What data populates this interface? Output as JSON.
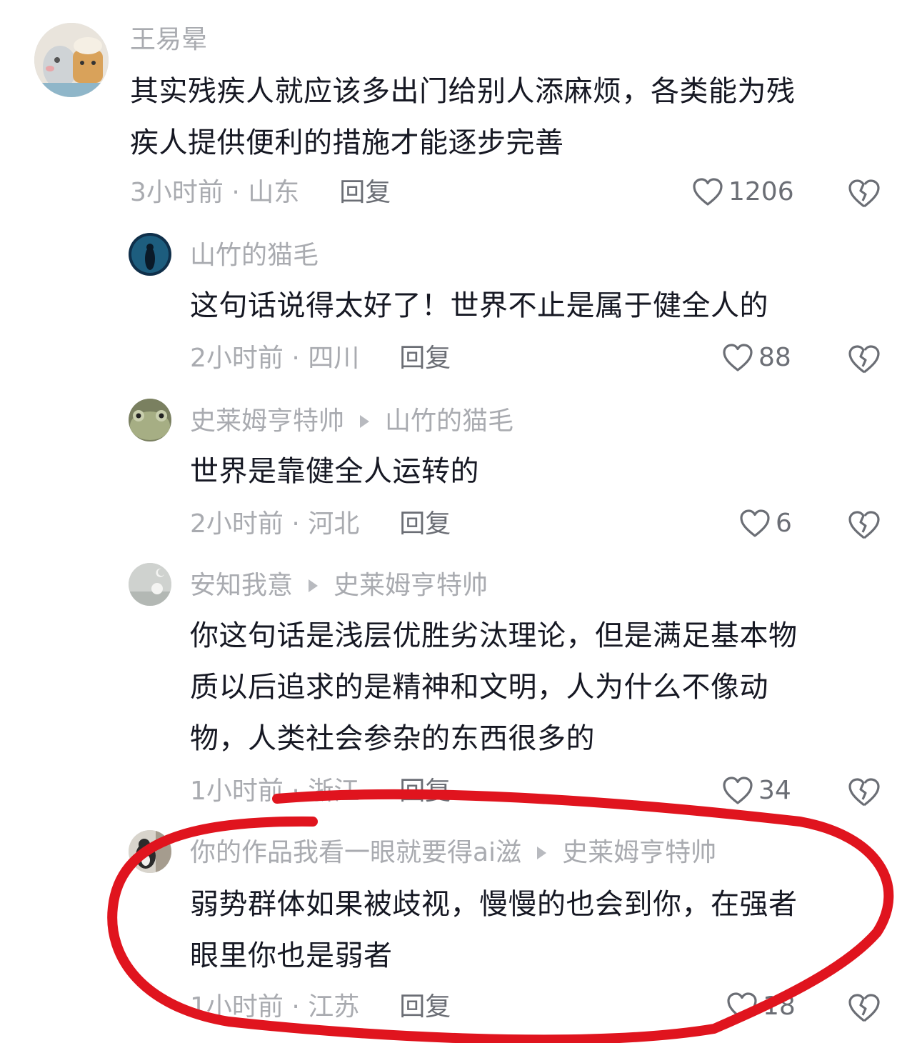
{
  "comments": [
    {
      "user": "王易晕",
      "text": [
        "其实残疾人就应该多出门给别人添麻烦，各类能为残",
        "疾人提供便利的措施才能逐步完善"
      ],
      "time_location": "3小时前 · 山东",
      "reply_label": "回复",
      "likes": "1206"
    },
    {
      "user": "山竹的猫毛",
      "text": [
        "这句话说得太好了！世界不止是属于健全人的"
      ],
      "time_location": "2小时前 · 四川",
      "reply_label": "回复",
      "likes": "88"
    },
    {
      "user": "史莱姆亨特帅",
      "reply_to": "山竹的猫毛",
      "text": [
        "世界是靠健全人运转的"
      ],
      "time_location": "2小时前 · 河北",
      "reply_label": "回复",
      "likes": "6"
    },
    {
      "user": "安知我意",
      "reply_to": "史莱姆亨特帅",
      "text": [
        "你这句话是浅层优胜劣汰理论，但是满足基本物",
        "质以后追求的是精神和文明，人为什么不像动",
        "物，人类社会参杂的东西很多的"
      ],
      "time_location": "1小时前 · 浙江",
      "reply_label": "回复",
      "likes": "34"
    },
    {
      "user": "你的作品我看一眼就要得ai滋",
      "reply_to": "史莱姆亨特帅",
      "text": [
        "弱势群体如果被歧视，慢慢的也会到你，在强者",
        "眼里你也是弱者"
      ],
      "time_location": "1小时前 · 江苏",
      "reply_label": "回复",
      "likes": "18"
    }
  ],
  "colors": {
    "highlight_stroke": "#e0141e",
    "meta_text": "#a9abb0",
    "body_text": "#161823"
  },
  "icons": {
    "like": "heart-outline-icon",
    "dislike": "broken-heart-icon"
  }
}
